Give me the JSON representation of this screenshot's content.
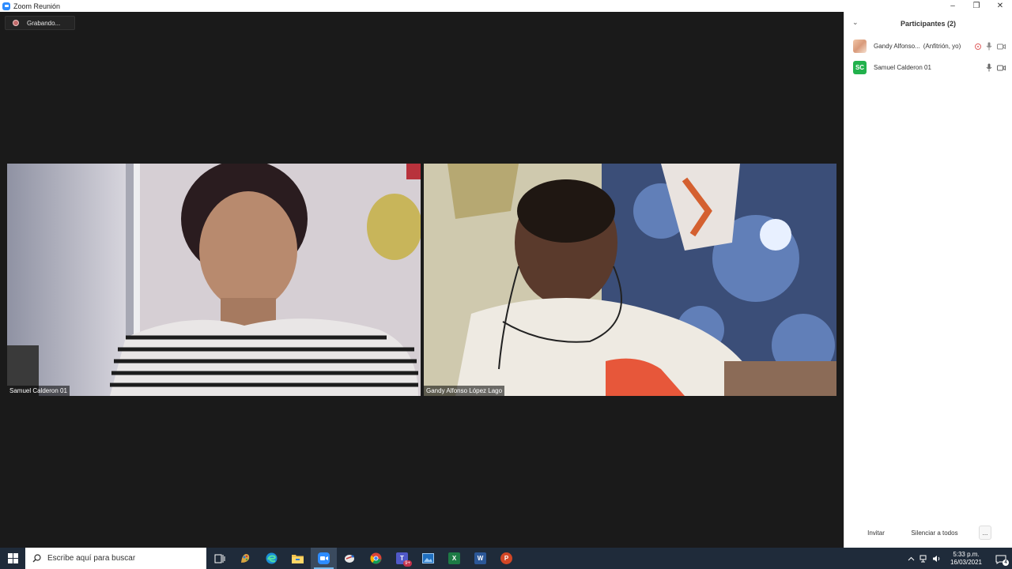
{
  "window": {
    "title": "Zoom Reunión",
    "controls": {
      "minimize": "–",
      "restore": "❐",
      "close": "✕"
    }
  },
  "meeting": {
    "recording_label": "Grabando...",
    "tiles": [
      {
        "name": "Samuel Calderon 01"
      },
      {
        "name": "Gandy Alfonso López Lago"
      }
    ]
  },
  "participants_panel": {
    "title": "Participantes (2)",
    "participants": [
      {
        "name": "Gandy Alfonso...",
        "role": "(Anfitrión, yo)",
        "avatar": "photo"
      },
      {
        "name": "Samuel Calderon 01",
        "initials": "SC",
        "avatar": "initials"
      }
    ],
    "footer": {
      "invite_label": "Invitar",
      "mute_all_label": "Silenciar a todos",
      "more_label": "..."
    }
  },
  "taskbar": {
    "search_placeholder": "Escribe aquí para buscar",
    "apps": [
      {
        "icon": "task-view-icon"
      },
      {
        "icon": "paint-app-icon"
      },
      {
        "icon": "edge-icon"
      },
      {
        "icon": "file-explorer-icon"
      },
      {
        "icon": "zoom-icon",
        "active": true
      },
      {
        "icon": "snipping-icon"
      },
      {
        "icon": "chrome-icon"
      },
      {
        "icon": "teams-icon",
        "badge": "9+"
      },
      {
        "icon": "photos-icon"
      },
      {
        "icon": "excel-icon",
        "letter": "X"
      },
      {
        "icon": "word-icon",
        "letter": "W"
      },
      {
        "icon": "powerpoint-icon",
        "letter": "P"
      }
    ],
    "clock": {
      "time": "5:33 p.m.",
      "date": "16/03/2021"
    },
    "notification_count": "4"
  },
  "colors": {
    "meeting_bg": "#1a1a1a",
    "taskbar_bg": "#1f2b3a",
    "zoom_blue": "#2d8cff",
    "sc_avatar": "#22b14c"
  }
}
